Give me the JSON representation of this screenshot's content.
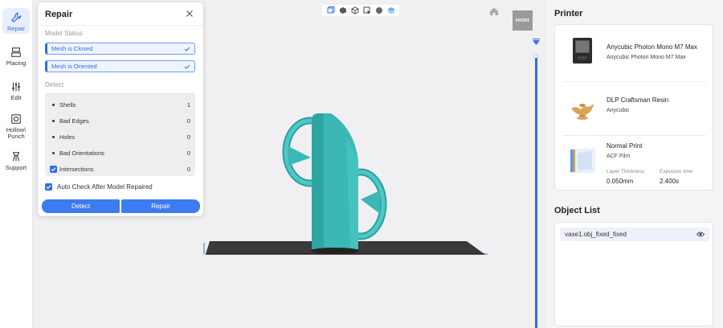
{
  "toolbar": {
    "items": [
      {
        "label": "Repair",
        "icon": "wrench-icon"
      },
      {
        "label": "Placing",
        "icon": "placing-icon"
      },
      {
        "label": "Edit",
        "icon": "sliders-icon"
      },
      {
        "label": "Hollow\\ Punch",
        "icon": "hollow-icon"
      },
      {
        "label": "Support",
        "icon": "support-icon"
      }
    ]
  },
  "viewport": {
    "view_buttons": [
      "view-cube-icon",
      "solid-view-icon",
      "wireframe-icon",
      "select-icon",
      "sphere-icon",
      "slice-view-icon"
    ],
    "front_label": "FRONT"
  },
  "repair": {
    "title": "Repair",
    "model_status_label": "Model Status",
    "status_items": [
      "Mesh is Closed",
      "Mesh is Oriented"
    ],
    "detect_label": "Detect",
    "detect_items": [
      {
        "label": "Shells",
        "value": "1"
      },
      {
        "label": "Bad Edges",
        "value": "0"
      },
      {
        "label": "Holes",
        "value": "0"
      },
      {
        "label": "Bad Orientations",
        "value": "0"
      },
      {
        "label": "Intersections",
        "value": "0"
      }
    ],
    "auto_check_label": "Auto Check After Model Repaired",
    "detect_button": "Detect",
    "repair_button": "Repair"
  },
  "printer": {
    "heading": "Printer",
    "machine_title": "Anycubic Photon Mono M7 Max",
    "machine_sub": "Anycubic Photon Mono M7 Max",
    "resin_title": "DLP Craftsman Resin",
    "resin_sub": "Anycubic",
    "print_title": "Normal Print",
    "print_sub": "ACF Film",
    "layer_thickness_label": "Layer Thickness",
    "layer_thickness_value": "0.050mm",
    "exposure_label": "Exposure time",
    "exposure_value": "2.400s"
  },
  "object_list": {
    "heading": "Object List",
    "items": [
      "vase1.obj_fixed_fixed"
    ]
  },
  "colors": {
    "accent": "#2f6ee8",
    "model": "#3bb8b6",
    "viewport_bg": "#f0f0f2"
  }
}
